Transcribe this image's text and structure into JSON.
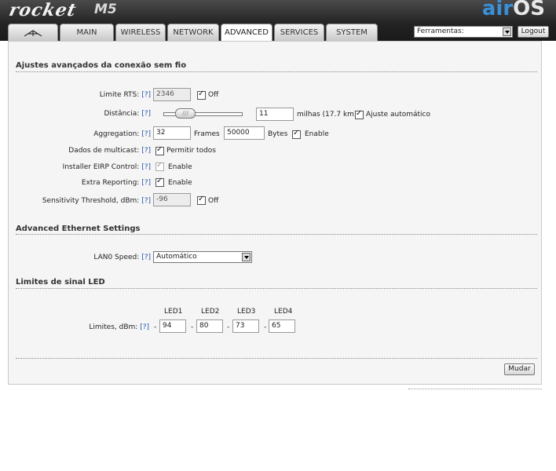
{
  "header": {
    "logo_text": "rocket",
    "logo_model": "M5",
    "brand_air": "air",
    "brand_os": "OS",
    "tools_select": "Ferramentas:",
    "logout_label": "Logout"
  },
  "tabs": [
    {
      "label": ""
    },
    {
      "label": "MAIN"
    },
    {
      "label": "WIRELESS"
    },
    {
      "label": "NETWORK"
    },
    {
      "label": "ADVANCED"
    },
    {
      "label": "SERVICES"
    },
    {
      "label": "SYSTEM"
    }
  ],
  "help": "[?]",
  "wireless": {
    "title": "Ajustes avançados da conexão sem fio",
    "rts": {
      "label": "Limite RTS:",
      "value": "2346",
      "cb_label": "Off"
    },
    "distance": {
      "label": "Distância:",
      "value": "11",
      "unit": "milhas (17.7 km)",
      "cb_label": "Ajuste automático",
      "slider_fraction": 0.2
    },
    "aggregation": {
      "label": "Aggregation:",
      "frames": "32",
      "frames_label": "Frames",
      "bytes": "50000",
      "bytes_label": "Bytes",
      "cb_label": "Enable"
    },
    "multicast": {
      "label": "Dados de multicast:",
      "cb_label": "Permitir todos"
    },
    "eirp": {
      "label": "Installer EIRP Control:",
      "cb_label": "Enable"
    },
    "extra": {
      "label": "Extra Reporting:",
      "cb_label": "Enable"
    },
    "sensitivity": {
      "label": "Sensitivity Threshold, dBm:",
      "value": "-96",
      "cb_label": "Off"
    }
  },
  "ethernet": {
    "title": "Advanced Ethernet Settings",
    "lan_label": "LAN0 Speed:",
    "lan_value": "Automático"
  },
  "led": {
    "title": "Limites de sinal LED",
    "headers": [
      "LED1",
      "LED2",
      "LED3",
      "LED4"
    ],
    "label": "Limites, dBm:",
    "values": [
      "94",
      "80",
      "73",
      "65"
    ],
    "dash": "-"
  },
  "apply_label": "Mudar"
}
